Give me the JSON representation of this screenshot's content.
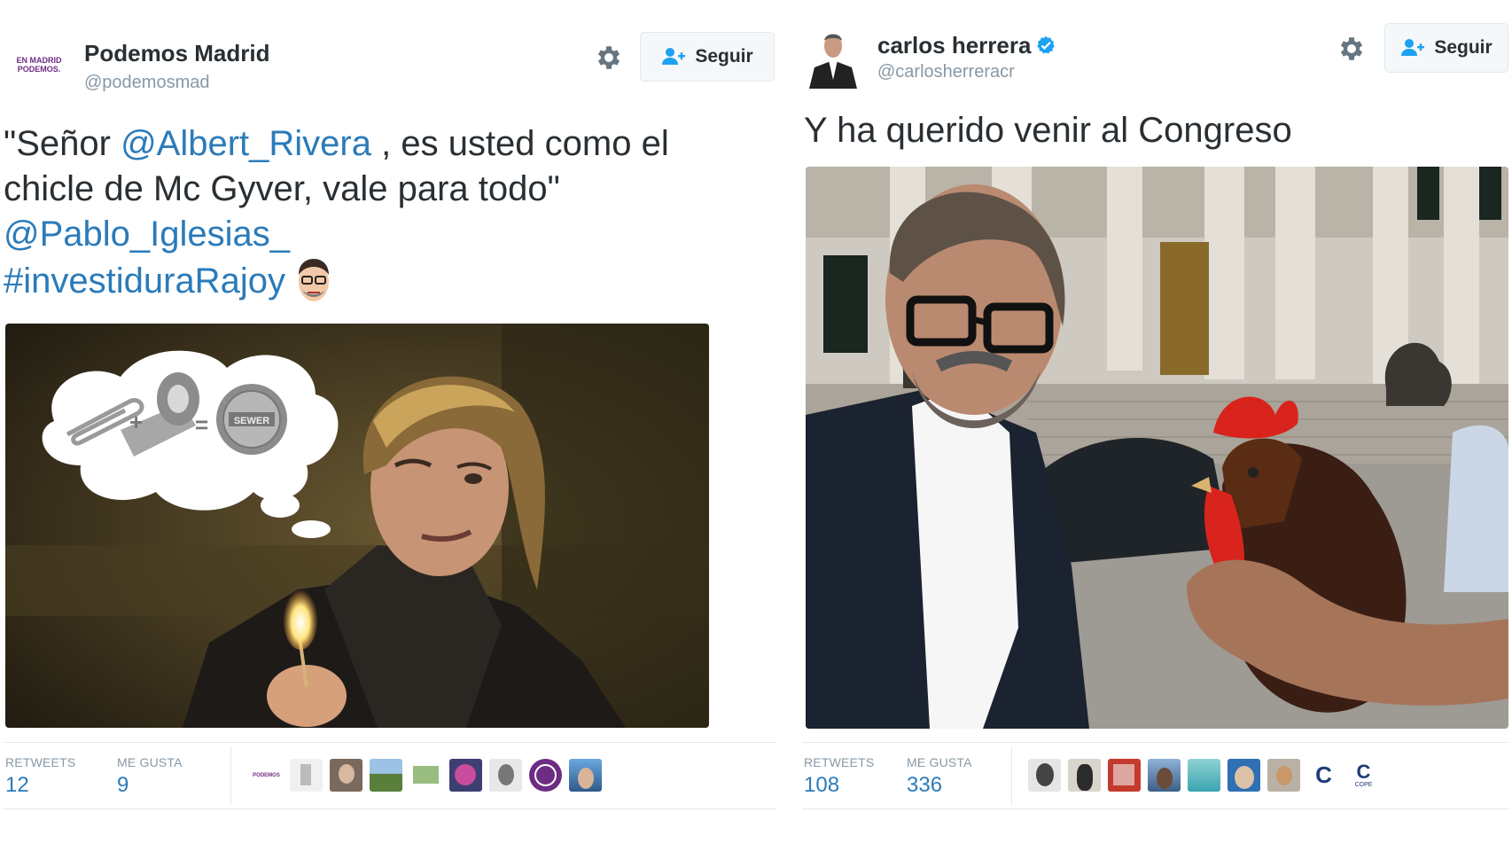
{
  "colors": {
    "link": "#2b7bb9",
    "muted": "#8899a6",
    "text": "#292f33",
    "verified": "#1da1f2",
    "podemos_purple": "#6d2c83"
  },
  "left_tweet": {
    "avatar_text": "EN MADRID PODEMOS.",
    "name": "Podemos Madrid",
    "handle": "@podemosmad",
    "settings_icon": "gear-icon",
    "follow_label": "Seguir",
    "follow_icon": "add-user-icon",
    "text": {
      "quote_open": "\"Señor ",
      "mention1": "@Albert_Rivera",
      "seg2": " , es usted como el",
      "line2": "chicle de Mc Gyver, vale para todo\"",
      "mention2": "@Pablo_Iglesias_",
      "hashtag": "#investiduraRajoy",
      "emoji": "rajoy-face-emoji"
    },
    "media": {
      "bubble_plus": "+",
      "bubble_equals": "=",
      "bubble_label": "SEWER"
    },
    "stats": {
      "retweets_label": "RETWEETS",
      "retweets": "12",
      "likes_label": "ME GUSTA",
      "likes": "9",
      "likers_first": "PODEMOS"
    }
  },
  "right_tweet": {
    "name": "carlos herrera",
    "verified_icon": "verified-badge-icon",
    "handle": "@carlosherreracr",
    "settings_icon": "gear-icon",
    "follow_label": "Seguir",
    "follow_icon": "add-user-icon",
    "text": "Y ha querido venir al Congreso",
    "stats": {
      "retweets_label": "RETWEETS",
      "retweets": "108",
      "likes_label": "ME GUSTA",
      "likes": "336",
      "likers_letter": "C",
      "likers_cope": "COPE"
    }
  }
}
